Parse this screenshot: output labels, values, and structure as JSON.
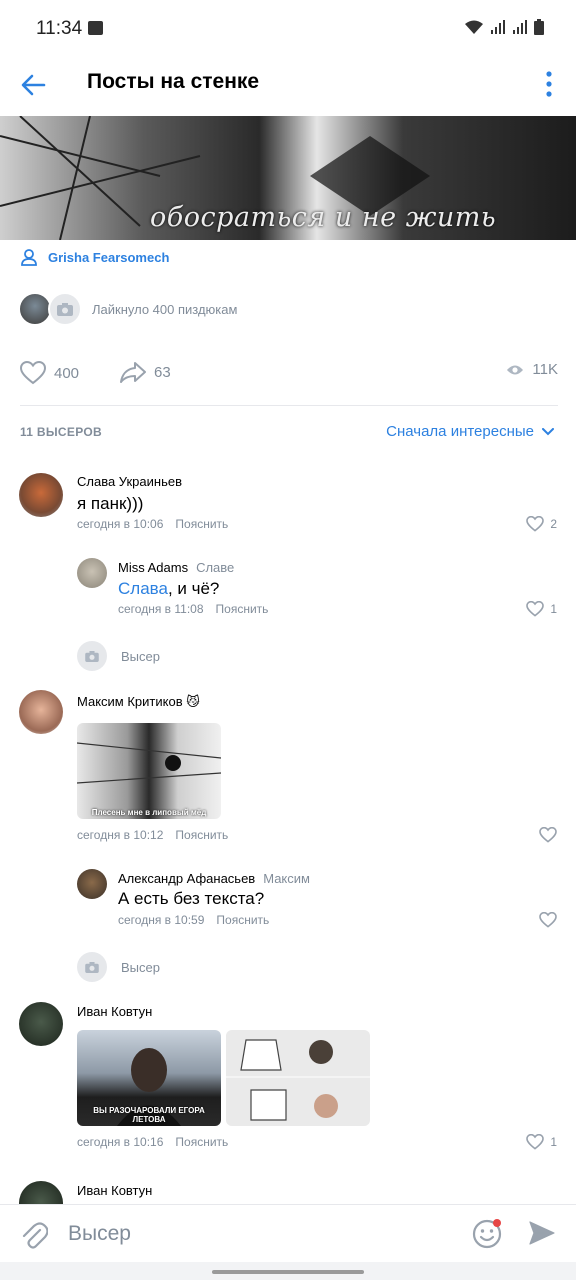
{
  "status": {
    "time": "11:34"
  },
  "header": {
    "title": "Посты на стенке"
  },
  "banner": {
    "caption": "обосраться и не жить"
  },
  "post": {
    "author": "Grisha Fearsomech",
    "likes_text": "Лайкнуло 400 пиздюкам",
    "likes": "400",
    "shares": "63",
    "views": "11K"
  },
  "comments_header": {
    "count": "11 ВЫСЕРОВ",
    "sort": "Сначала интересные"
  },
  "comments": [
    {
      "name": "Слава Украиньев",
      "text": "я панк)))",
      "time": "сегодня в 10:06",
      "explain": "Пояснить",
      "likes": "2"
    },
    {
      "name": "Miss Adams",
      "reply_to": "Славе",
      "link": "Слава",
      "text_rest": ", и чё?",
      "time": "сегодня в 11:08",
      "explain": "Пояснить",
      "likes": "1"
    },
    {
      "name": "Максим Критиков 😼",
      "image_caption": "Плесень мне в липовый мёд",
      "time": "сегодня в 10:12",
      "explain": "Пояснить"
    },
    {
      "name": "Александр Афанасьев",
      "reply_to": "Максим",
      "text": "А есть без текста?",
      "time": "сегодня в 10:59",
      "explain": "Пояснить"
    },
    {
      "name": "Иван Ковтун",
      "image_caption": "ВЫ РАЗОЧАРОВАЛИ ЕГОРА ЛЕТОВА",
      "time": "сегодня в 10:16",
      "explain": "Пояснить",
      "likes": "1"
    },
    {
      "name": "Иван Ковтун"
    }
  ],
  "reply_placeholder": "Высер",
  "input": {
    "placeholder": "Высер"
  },
  "colors": {
    "accent": "#2d81e0",
    "secondary": "#818c99"
  }
}
